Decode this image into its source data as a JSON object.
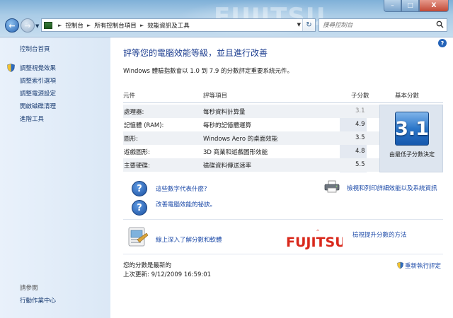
{
  "window": {
    "watermark": "FUJITSU",
    "min": "–",
    "max": "□",
    "close": "X"
  },
  "nav": {
    "back": "←",
    "forward": "→",
    "dropdown": "▼"
  },
  "address": {
    "crumbs": [
      "控制台",
      "所有控制台項目",
      "效能資訊及工具"
    ],
    "separator": "►",
    "dropdown": "▼",
    "refresh": "↻"
  },
  "search": {
    "placeholder": "搜尋控制台",
    "icon": "magnifier-icon"
  },
  "sidebar": {
    "home": "控制台首頁",
    "items": [
      {
        "label": "調整視覺效果",
        "icon": "shield-icon"
      },
      {
        "label": "調整索引選項"
      },
      {
        "label": "調整電源設定"
      },
      {
        "label": "開啟磁碟清理"
      },
      {
        "label": "進階工具"
      }
    ],
    "see_also_title": "請參閱",
    "see_also": [
      "行動作業中心"
    ]
  },
  "main": {
    "title": "評等您的電腦效能等級，並且進行改善",
    "subtitle": "Windows 體驗指數會以 1.0 到 7.9 的分數評定重要系統元件。",
    "help": "?",
    "columns": {
      "component": "元件",
      "rated": "評等項目",
      "subscore": "子分數",
      "base": "基本分數"
    },
    "rows": [
      {
        "component": "處理器:",
        "rated": "每秒資料計算量",
        "subscore": "3.1"
      },
      {
        "component": "記憶體 (RAM):",
        "rated": "每秒的記憶體運算",
        "subscore": "4.9"
      },
      {
        "component": "圖形:",
        "rated": "Windows Aero 的桌面效能",
        "subscore": "3.5"
      },
      {
        "component": "遊戲圖形:",
        "rated": "3D 商業和遊戲圖形效能",
        "subscore": "4.8"
      },
      {
        "component": "主要硬碟:",
        "rated": "磁碟資料傳送速率",
        "subscore": "5.5"
      }
    ],
    "base_score": "3.1",
    "base_caption": "由最低子分數決定",
    "links": {
      "what_mean": "這些數字代表什麼?",
      "tips": "改善電腦效能的祕訣。",
      "view_print": "檢視和列印詳細效能以及系統資訊",
      "learn_software": "線上深入了解分數和軟體",
      "improve": "檢視提升分數的方法"
    },
    "brand": "FUJITSU",
    "status": "您的分數是最新的",
    "last_update": "上次更新: 9/12/2009 16:59:01",
    "rerun": "重新執行評定"
  },
  "colors": {
    "title": "#1e3f91",
    "link": "#1c4aa8",
    "sidebar_link": "#1a3c72",
    "brand_red": "#d9291c"
  }
}
